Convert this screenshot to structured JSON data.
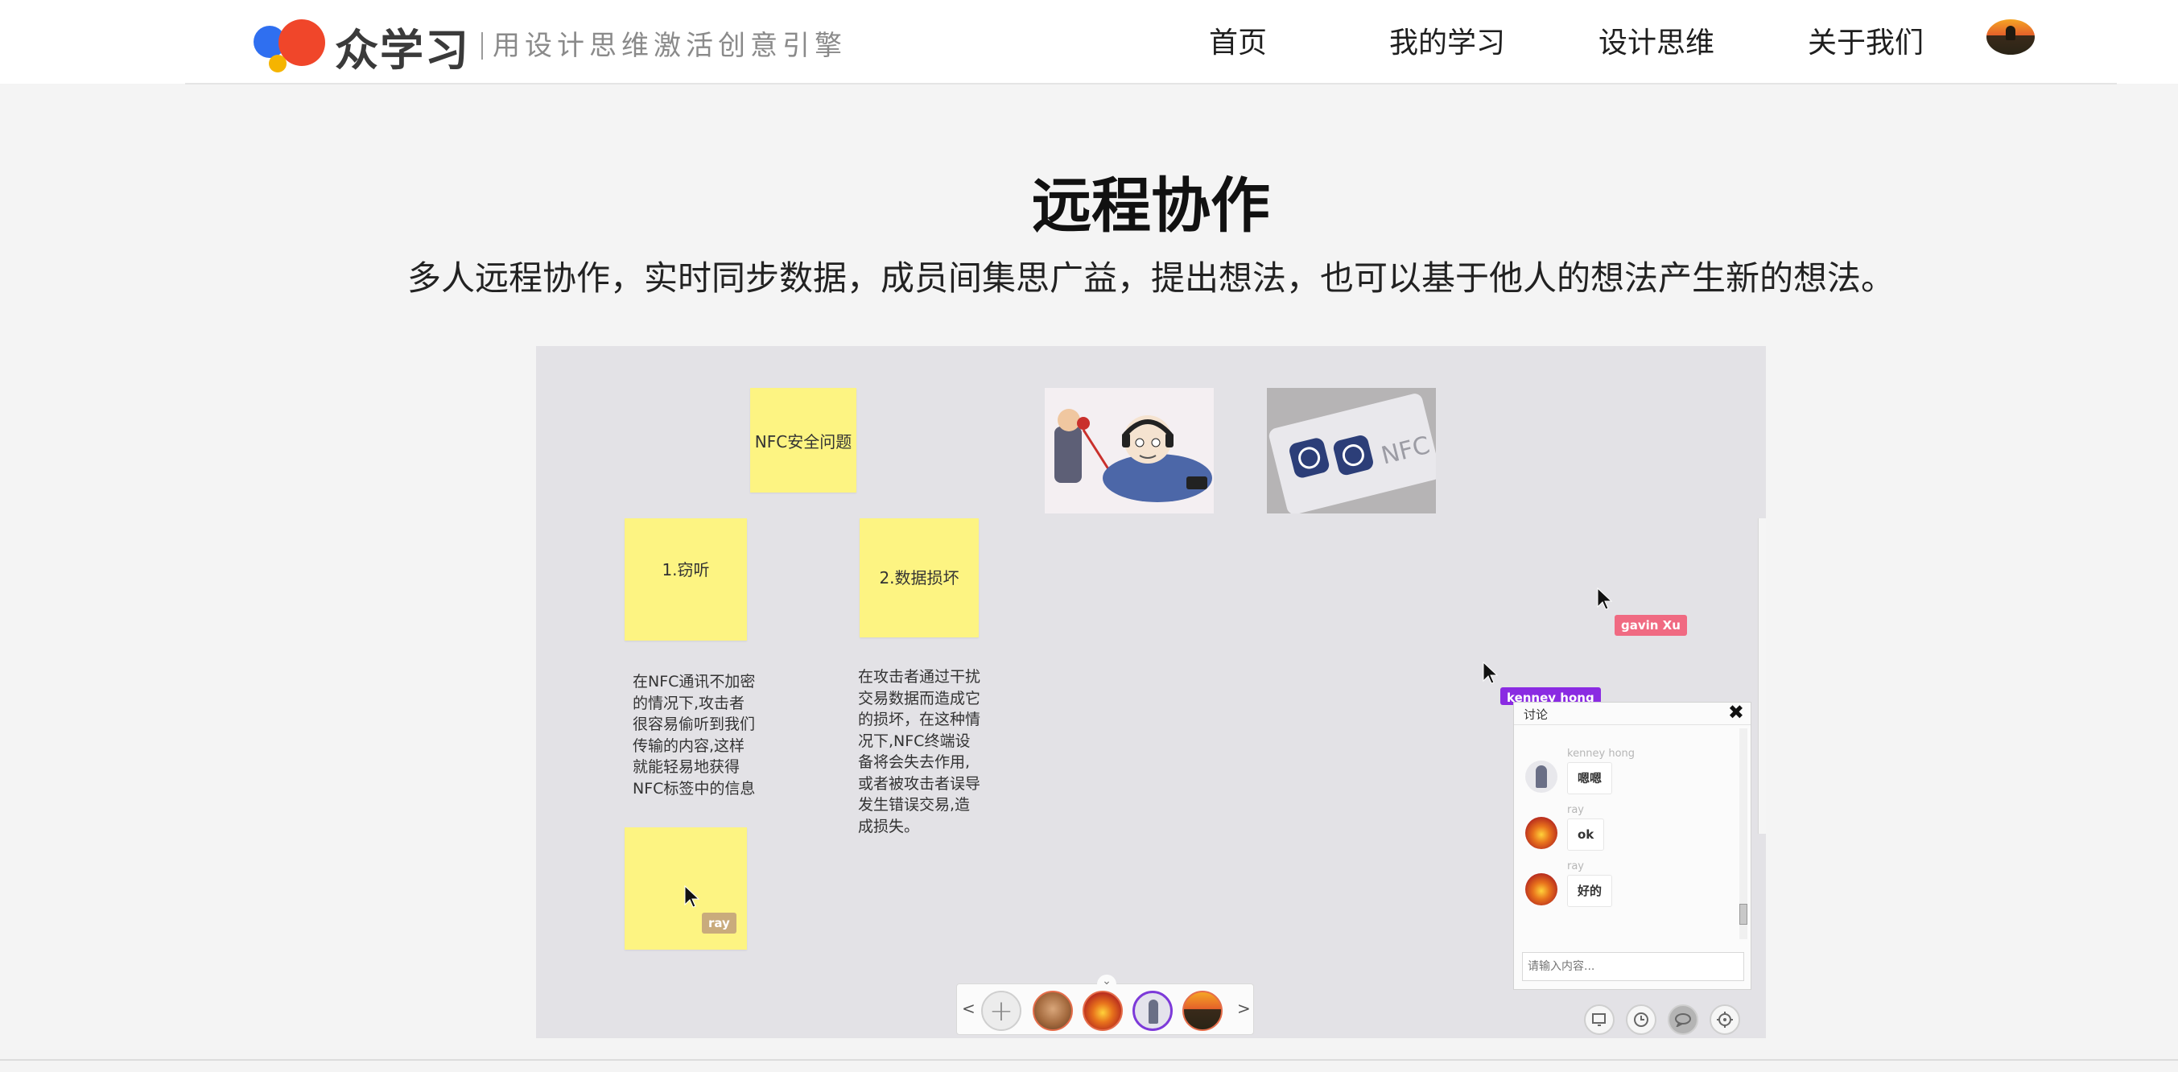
{
  "header": {
    "brand": "众学习",
    "slogan": "用设计思维激活创意引擎",
    "nav": [
      "首页",
      "我的学习",
      "设计思维",
      "关于我们"
    ]
  },
  "hero": {
    "title": "远程协作",
    "subtitle": "多人远程协作，实时同步数据，成员间集思广益，提出想法，也可以基于他人的想法产生新的想法。"
  },
  "board": {
    "stickies": [
      {
        "text": "NFC安全问题"
      },
      {
        "text": "1.窃听"
      },
      {
        "text": "2.数据损坏"
      },
      {
        "text": ""
      }
    ],
    "notes": [
      {
        "text": "在NFC通讯不加密\n的情况下,攻击者\n很容易偷听到我们\n传输的内容,这样\n就能轻易地获得\nNFC标签中的信息"
      },
      {
        "text": "在攻击者通过干扰\n交易数据而造成它\n的损坏，在这种情\n况下,NFC终端设\n备将会失去作用,\n或者被攻击者误导\n发生错误交易,造\n成损失。"
      }
    ],
    "images": [
      {
        "icon": "spy-cartoon-image"
      },
      {
        "icon": "nfc-card-image",
        "label": "NFC"
      }
    ],
    "cursors": [
      {
        "user": "gavin Xu",
        "color": "#f06a82"
      },
      {
        "user": "kenney hong",
        "color": "#8a2be2"
      },
      {
        "user": "ray",
        "color": "#c9ab7c"
      }
    ]
  },
  "chat": {
    "title": "讨论",
    "close_icon": "✖",
    "messages": [
      {
        "user": "kenney hong",
        "text": "嗯嗯"
      },
      {
        "user": "ray",
        "text": "ok"
      },
      {
        "user": "ray",
        "text": "好的"
      }
    ],
    "input_placeholder": "请输入内容..."
  },
  "members": {
    "prev": "<",
    "next": ">",
    "add_icon": "+"
  },
  "tools": [
    "screen-icon",
    "clock-icon",
    "chat-icon",
    "target-icon"
  ]
}
